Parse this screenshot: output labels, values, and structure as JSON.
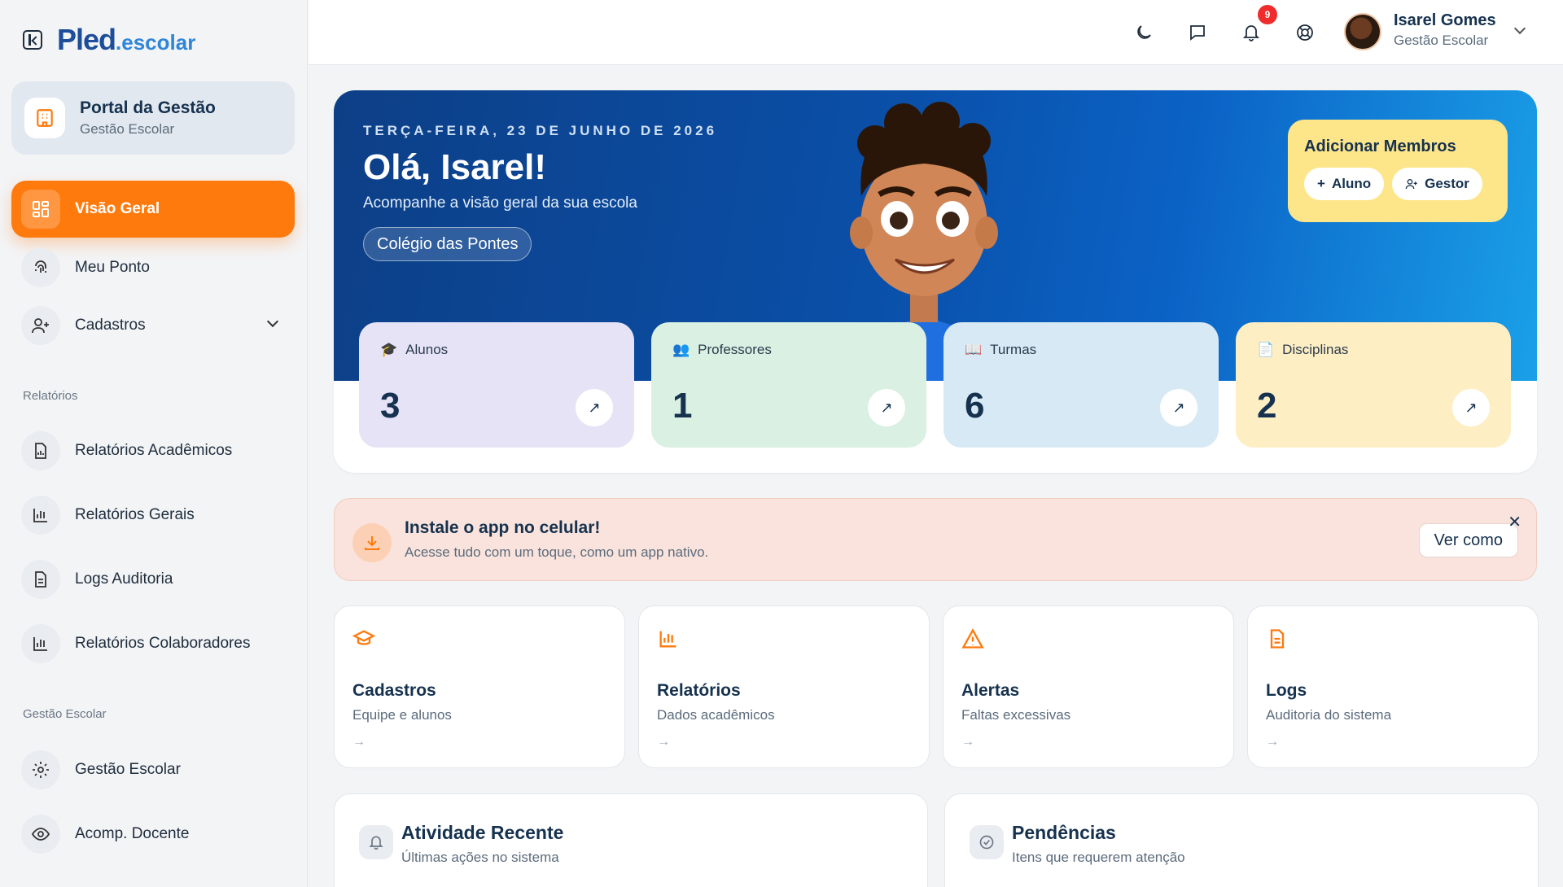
{
  "brand": {
    "logo_main": "Pled",
    "logo_sub": ".escolar"
  },
  "portal": {
    "title": "Portal da Gestão",
    "subtitle": "Gestão Escolar"
  },
  "nav": {
    "items": [
      {
        "label": "Visão Geral",
        "icon": "dashboard-grid-icon",
        "active": true
      },
      {
        "label": "Meu Ponto",
        "icon": "fingerprint-icon"
      },
      {
        "label": "Cadastros",
        "icon": "user-plus-icon"
      }
    ],
    "section_reports": "Relatórios",
    "reports": [
      {
        "label": "Relatórios Acadêmicos",
        "icon": "file-chart-icon"
      },
      {
        "label": "Relatórios Gerais",
        "icon": "bar-chart-icon"
      },
      {
        "label": "Logs Auditoria",
        "icon": "file-text-icon"
      },
      {
        "label": "Relatórios Colaboradores",
        "icon": "bar-chart-icon"
      }
    ],
    "section_management": "Gestão Escolar",
    "management": [
      {
        "label": "Gestão Escolar",
        "icon": "gear-icon"
      },
      {
        "label": "Acomp. Docente",
        "icon": "eye-icon"
      }
    ]
  },
  "topbar": {
    "notification_count": "9",
    "user_name": "Isarel Gomes",
    "user_role": "Gestão Escolar"
  },
  "hero": {
    "date": "TERÇA-FEIRA, 23 DE JUNHO DE 2026",
    "greeting": "Olá, Isarel!",
    "subtitle": "Acompanhe a visão geral da sua escola",
    "school": "Colégio das Pontes",
    "members_title": "Adicionar Membros",
    "add_student": "Aluno",
    "add_manager": "Gestor"
  },
  "stats": [
    {
      "label": "Alunos",
      "value": "3",
      "color": "#e6e3f7",
      "icon": "graduation-cap-icon"
    },
    {
      "label": "Professores",
      "value": "1",
      "color": "#d9f0e2",
      "icon": "users-icon"
    },
    {
      "label": "Turmas",
      "value": "6",
      "color": "#d6e9f5",
      "icon": "book-icon"
    },
    {
      "label": "Disciplinas",
      "value": "2",
      "color": "#fdeec4",
      "icon": "document-icon"
    }
  ],
  "install": {
    "title": "Instale o app no celular!",
    "subtitle": "Acesse tudo com um toque, como um app nativo.",
    "button": "Ver como"
  },
  "quick": [
    {
      "title": "Cadastros",
      "subtitle": "Equipe e alunos",
      "icon": "graduation-cap-icon"
    },
    {
      "title": "Relatórios",
      "subtitle": "Dados acadêmicos",
      "icon": "bar-chart-icon"
    },
    {
      "title": "Alertas",
      "subtitle": "Faltas excessivas",
      "icon": "warning-icon"
    },
    {
      "title": "Logs",
      "subtitle": "Auditoria do sistema",
      "icon": "file-text-icon"
    }
  ],
  "panels": [
    {
      "title": "Atividade Recente",
      "subtitle": "Últimas ações no sistema",
      "icon": "bell-icon"
    },
    {
      "title": "Pendências",
      "subtitle": "Itens que requerem atenção",
      "icon": "check-circle-icon"
    }
  ],
  "colors": {
    "accent": "#ff7a0d",
    "primary": "#0a4fa8",
    "yellow": "#fde58a"
  }
}
